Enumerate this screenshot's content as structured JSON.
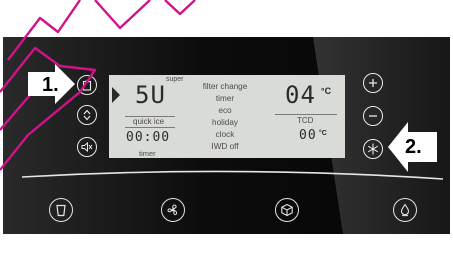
{
  "display": {
    "left_section": {
      "top_value": "5U",
      "top_badge": "super",
      "top_label": "quick ice",
      "bottom_value": "00:00",
      "bottom_label": "timer"
    },
    "menu_items": [
      "filter change",
      "timer",
      "eco",
      "holiday",
      "clock",
      "IWD off"
    ],
    "right_section": {
      "top_value": "04",
      "top_unit": "°C",
      "middle_label": "TCD",
      "bottom_value": "00",
      "bottom_unit": "°C"
    }
  },
  "callouts": {
    "one": "1.",
    "two": "2."
  },
  "colors": {
    "panel": "#0a0a0a",
    "lcd": "#d9dbd6",
    "marker": "#d0138a",
    "icon_stroke": "#e9e9e9"
  },
  "icons": {
    "left_column": [
      "clipboard-icon",
      "up-down-icon",
      "speaker-mute-icon"
    ],
    "right_column": [
      "plus-icon",
      "minus-icon",
      "snowflake-icon"
    ],
    "bottom_row": [
      "water-glass-icon",
      "fan-icon",
      "cube-icon",
      "ice-drop-icon"
    ]
  }
}
